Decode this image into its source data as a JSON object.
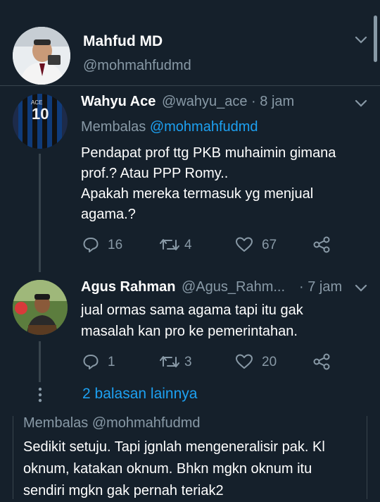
{
  "header": {
    "name": "Mahfud MD",
    "handle": "@mohmahfudmd"
  },
  "replies": [
    {
      "name": "Wahyu Ace",
      "handle_time": "@wahyu_ace · 8 jam",
      "replying_prefix": "Membalas",
      "replying_handle": "@mohmahfudmd",
      "text_lines": [
        "Pendapat prof ttg PKB muhaimin gimana",
        "prof.? Atau PPP Romy..",
        "Apakah mereka termasuk yg menjual",
        "agama.?"
      ],
      "counts": {
        "reply": "16",
        "retweet": "4",
        "like": "67"
      }
    },
    {
      "name": "Agus Rahman",
      "handle": "@Agus_Rahm...",
      "time": "· 7 jam",
      "text_lines": [
        "jual ormas sama agama tapi itu gak",
        "masalah kan pro ke pemerintahan."
      ],
      "counts": {
        "reply": "1",
        "retweet": "3",
        "like": "20"
      }
    }
  ],
  "more_replies": "2 balasan lainnya",
  "next_reply": {
    "replying": "Membalas @mohmahfudmd",
    "text_lines": [
      "Sedikit setuju. Tapi jgnlah mengeneralisir pak. Kl",
      "oknum, katakan oknum. Bhkn mgkn oknum itu",
      "sendiri mgkn gak pernah teriak2"
    ]
  },
  "icons": [
    "chevron-down-icon",
    "reply-icon",
    "retweet-icon",
    "like-icon",
    "share-icon"
  ],
  "colors": {
    "background": "#15202b",
    "accent": "#1da1f2",
    "muted": "#8899a6"
  }
}
